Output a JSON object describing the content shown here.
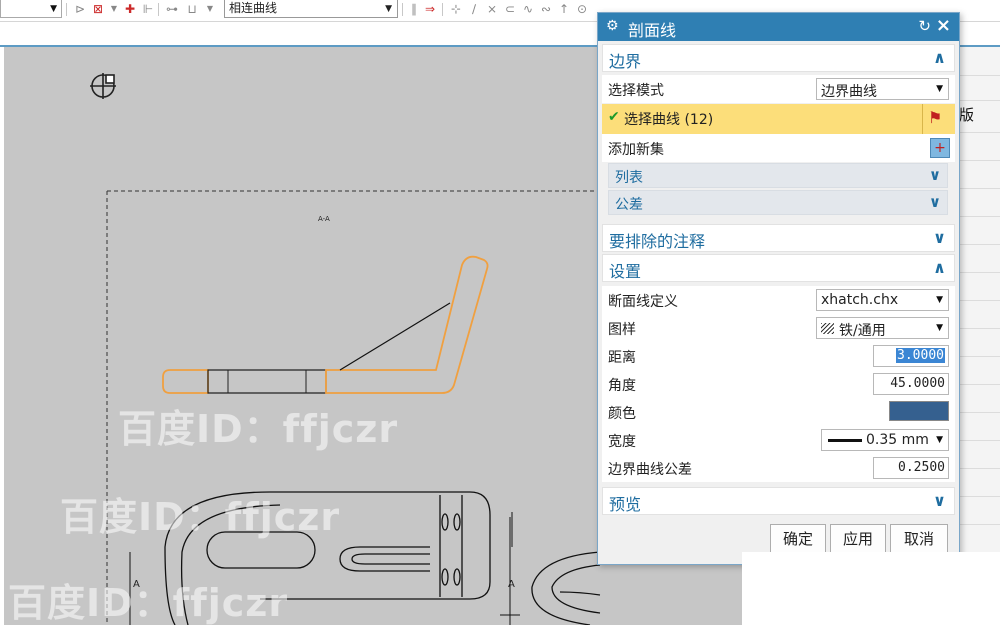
{
  "toolbar": {
    "curve_rule": "相连曲线"
  },
  "drawing": {
    "view_label": "A-A",
    "section_label_left": "A",
    "section_label_right": "A"
  },
  "watermark": {
    "text": "百度ID：ffjczr"
  },
  "right_strip": {
    "partial_char": "版"
  },
  "dialog": {
    "title": "剖面线",
    "boundary": {
      "label": "边界",
      "select_mode_label": "选择模式",
      "select_mode_value": "边界曲线",
      "select_curve_label": "选择曲线 (12)",
      "add_new_set_label": "添加新集",
      "list_label": "列表",
      "tolerance_label": "公差"
    },
    "exclude": {
      "label": "要排除的注释"
    },
    "settings": {
      "label": "设置",
      "hatch_def_label": "断面线定义",
      "hatch_def_value": "xhatch.chx",
      "pattern_label": "图样",
      "pattern_value": "铁/通用",
      "distance_label": "距离",
      "distance_value": "3.0000",
      "angle_label": "角度",
      "angle_value": "45.0000",
      "color_label": "颜色",
      "color_value": "#35608f",
      "width_label": "宽度",
      "width_value": "0.35 mm",
      "boundary_tol_label": "边界曲线公差",
      "boundary_tol_value": "0.2500"
    },
    "preview": {
      "label": "预览"
    },
    "buttons": {
      "ok": "确定",
      "apply": "应用",
      "cancel": "取消"
    }
  }
}
